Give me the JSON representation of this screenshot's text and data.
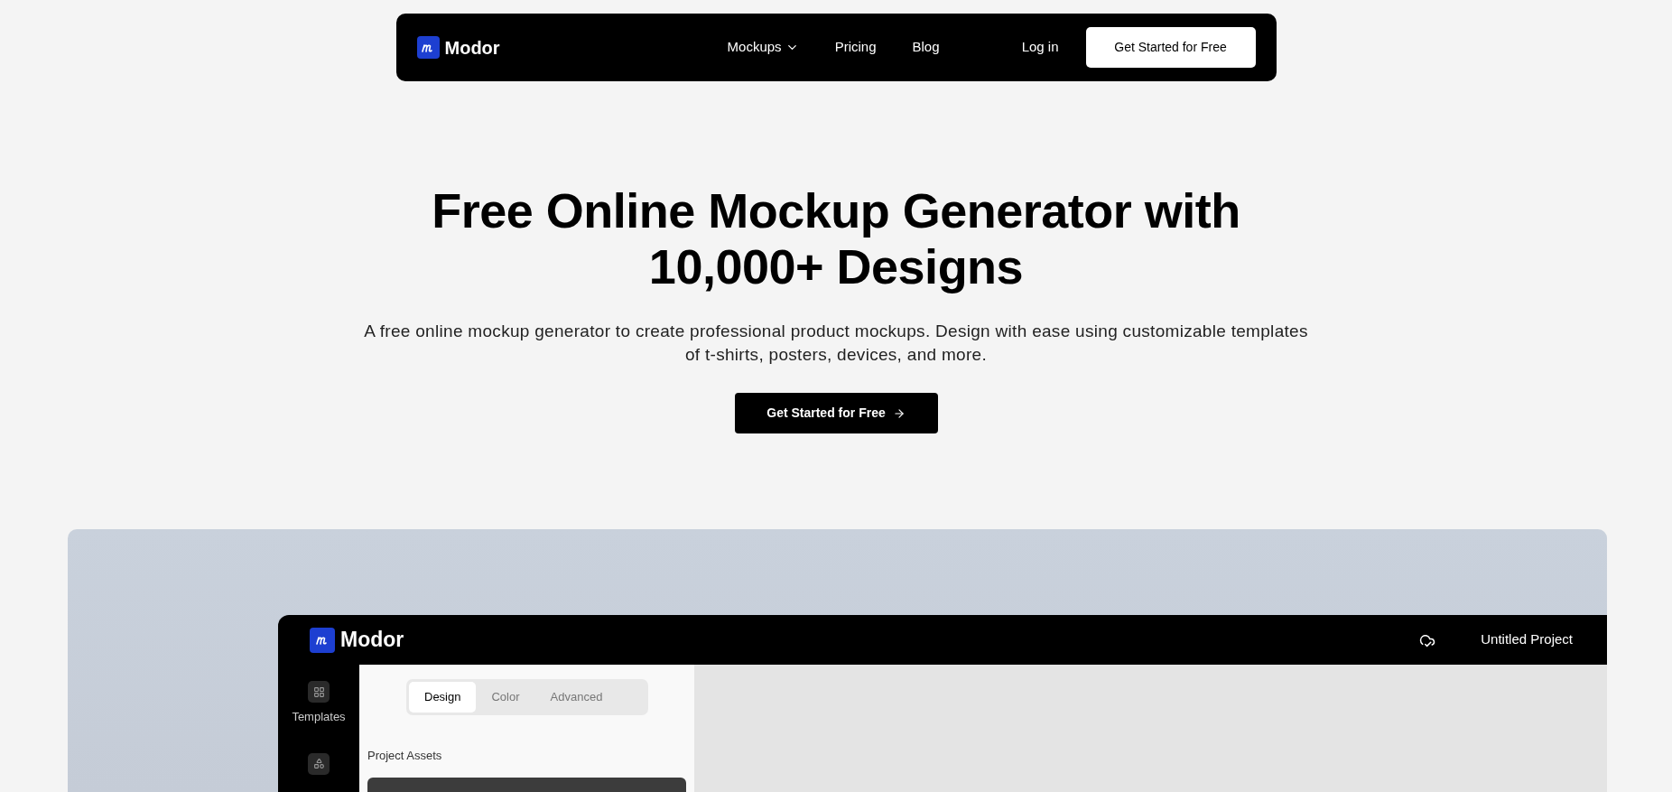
{
  "nav": {
    "logo": "Modor",
    "items": [
      {
        "label": "Mockups",
        "kind": "dropdown"
      },
      {
        "label": "Pricing",
        "kind": "link"
      },
      {
        "label": "Blog",
        "kind": "link"
      }
    ],
    "login": "Log in",
    "cta": "Get Started for Free"
  },
  "hero": {
    "title": "Free Online Mockup Generator with 10,000+ Designs",
    "subtitle": "A free online mockup generator to create professional product mockups. Design with ease using customizable templates of t-shirts, posters, devices, and more.",
    "cta": "Get Started for Free"
  },
  "app": {
    "logo": "Modor",
    "project": "Untitled Project",
    "sidebar": [
      {
        "label": "Templates",
        "kind": "grid"
      },
      {
        "kind": "shapes"
      }
    ],
    "tabs": [
      {
        "label": "Design",
        "selected": true
      },
      {
        "label": "Color",
        "selected": false
      },
      {
        "label": "Advanced",
        "selected": false
      }
    ],
    "section": "Project Assets"
  }
}
